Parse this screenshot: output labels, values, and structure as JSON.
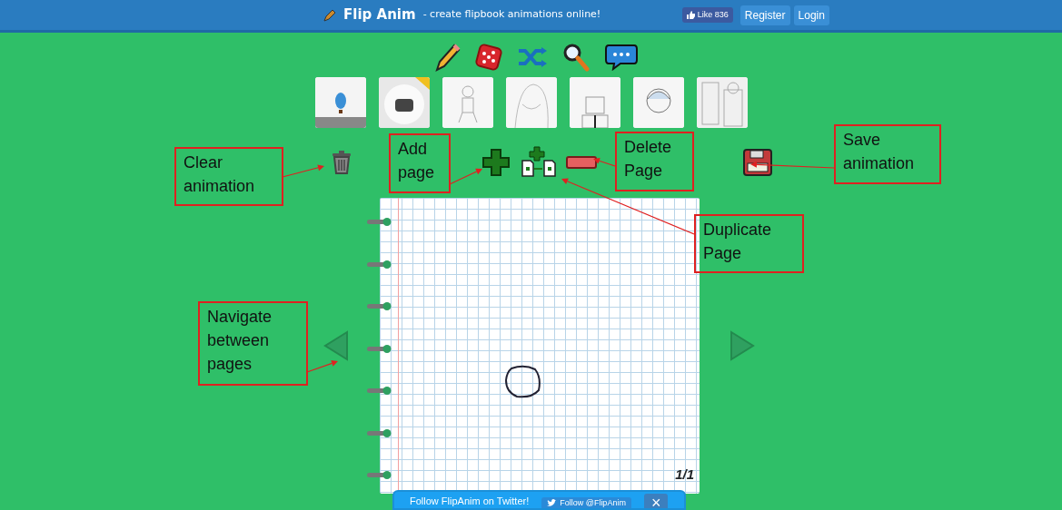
{
  "header": {
    "logo": "Flip Anim",
    "tagline": "- create flipbook animations online!",
    "like_button": "Like 836",
    "buttons": [
      "Register",
      "Login"
    ]
  },
  "notebook": {
    "page_counter": "1/1"
  },
  "twitter_bar": {
    "text": "Follow FlipAnim on Twitter!",
    "follow_button": "Follow @FlipAnim",
    "close": "×"
  },
  "annotations": [
    {
      "text": "Clear animation"
    },
    {
      "text": "Add page"
    },
    {
      "text": "Delete Page"
    },
    {
      "text": "Save animation"
    },
    {
      "text": "Duplicate Page"
    },
    {
      "text": "Navigate between pages"
    }
  ]
}
